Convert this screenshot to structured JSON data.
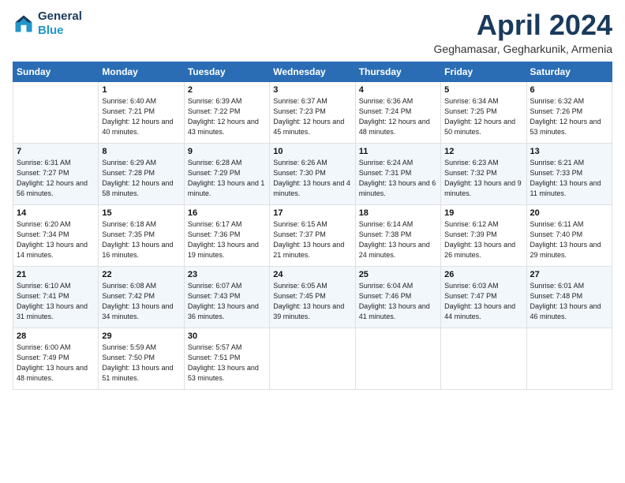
{
  "header": {
    "logo_line1": "General",
    "logo_line2": "Blue",
    "month": "April 2024",
    "location": "Geghamasar, Gegharkunik, Armenia"
  },
  "days_of_week": [
    "Sunday",
    "Monday",
    "Tuesday",
    "Wednesday",
    "Thursday",
    "Friday",
    "Saturday"
  ],
  "weeks": [
    [
      {
        "day": "",
        "sunrise": "",
        "sunset": "",
        "daylight": ""
      },
      {
        "day": "1",
        "sunrise": "Sunrise: 6:40 AM",
        "sunset": "Sunset: 7:21 PM",
        "daylight": "Daylight: 12 hours and 40 minutes."
      },
      {
        "day": "2",
        "sunrise": "Sunrise: 6:39 AM",
        "sunset": "Sunset: 7:22 PM",
        "daylight": "Daylight: 12 hours and 43 minutes."
      },
      {
        "day": "3",
        "sunrise": "Sunrise: 6:37 AM",
        "sunset": "Sunset: 7:23 PM",
        "daylight": "Daylight: 12 hours and 45 minutes."
      },
      {
        "day": "4",
        "sunrise": "Sunrise: 6:36 AM",
        "sunset": "Sunset: 7:24 PM",
        "daylight": "Daylight: 12 hours and 48 minutes."
      },
      {
        "day": "5",
        "sunrise": "Sunrise: 6:34 AM",
        "sunset": "Sunset: 7:25 PM",
        "daylight": "Daylight: 12 hours and 50 minutes."
      },
      {
        "day": "6",
        "sunrise": "Sunrise: 6:32 AM",
        "sunset": "Sunset: 7:26 PM",
        "daylight": "Daylight: 12 hours and 53 minutes."
      }
    ],
    [
      {
        "day": "7",
        "sunrise": "Sunrise: 6:31 AM",
        "sunset": "Sunset: 7:27 PM",
        "daylight": "Daylight: 12 hours and 56 minutes."
      },
      {
        "day": "8",
        "sunrise": "Sunrise: 6:29 AM",
        "sunset": "Sunset: 7:28 PM",
        "daylight": "Daylight: 12 hours and 58 minutes."
      },
      {
        "day": "9",
        "sunrise": "Sunrise: 6:28 AM",
        "sunset": "Sunset: 7:29 PM",
        "daylight": "Daylight: 13 hours and 1 minute."
      },
      {
        "day": "10",
        "sunrise": "Sunrise: 6:26 AM",
        "sunset": "Sunset: 7:30 PM",
        "daylight": "Daylight: 13 hours and 4 minutes."
      },
      {
        "day": "11",
        "sunrise": "Sunrise: 6:24 AM",
        "sunset": "Sunset: 7:31 PM",
        "daylight": "Daylight: 13 hours and 6 minutes."
      },
      {
        "day": "12",
        "sunrise": "Sunrise: 6:23 AM",
        "sunset": "Sunset: 7:32 PM",
        "daylight": "Daylight: 13 hours and 9 minutes."
      },
      {
        "day": "13",
        "sunrise": "Sunrise: 6:21 AM",
        "sunset": "Sunset: 7:33 PM",
        "daylight": "Daylight: 13 hours and 11 minutes."
      }
    ],
    [
      {
        "day": "14",
        "sunrise": "Sunrise: 6:20 AM",
        "sunset": "Sunset: 7:34 PM",
        "daylight": "Daylight: 13 hours and 14 minutes."
      },
      {
        "day": "15",
        "sunrise": "Sunrise: 6:18 AM",
        "sunset": "Sunset: 7:35 PM",
        "daylight": "Daylight: 13 hours and 16 minutes."
      },
      {
        "day": "16",
        "sunrise": "Sunrise: 6:17 AM",
        "sunset": "Sunset: 7:36 PM",
        "daylight": "Daylight: 13 hours and 19 minutes."
      },
      {
        "day": "17",
        "sunrise": "Sunrise: 6:15 AM",
        "sunset": "Sunset: 7:37 PM",
        "daylight": "Daylight: 13 hours and 21 minutes."
      },
      {
        "day": "18",
        "sunrise": "Sunrise: 6:14 AM",
        "sunset": "Sunset: 7:38 PM",
        "daylight": "Daylight: 13 hours and 24 minutes."
      },
      {
        "day": "19",
        "sunrise": "Sunrise: 6:12 AM",
        "sunset": "Sunset: 7:39 PM",
        "daylight": "Daylight: 13 hours and 26 minutes."
      },
      {
        "day": "20",
        "sunrise": "Sunrise: 6:11 AM",
        "sunset": "Sunset: 7:40 PM",
        "daylight": "Daylight: 13 hours and 29 minutes."
      }
    ],
    [
      {
        "day": "21",
        "sunrise": "Sunrise: 6:10 AM",
        "sunset": "Sunset: 7:41 PM",
        "daylight": "Daylight: 13 hours and 31 minutes."
      },
      {
        "day": "22",
        "sunrise": "Sunrise: 6:08 AM",
        "sunset": "Sunset: 7:42 PM",
        "daylight": "Daylight: 13 hours and 34 minutes."
      },
      {
        "day": "23",
        "sunrise": "Sunrise: 6:07 AM",
        "sunset": "Sunset: 7:43 PM",
        "daylight": "Daylight: 13 hours and 36 minutes."
      },
      {
        "day": "24",
        "sunrise": "Sunrise: 6:05 AM",
        "sunset": "Sunset: 7:45 PM",
        "daylight": "Daylight: 13 hours and 39 minutes."
      },
      {
        "day": "25",
        "sunrise": "Sunrise: 6:04 AM",
        "sunset": "Sunset: 7:46 PM",
        "daylight": "Daylight: 13 hours and 41 minutes."
      },
      {
        "day": "26",
        "sunrise": "Sunrise: 6:03 AM",
        "sunset": "Sunset: 7:47 PM",
        "daylight": "Daylight: 13 hours and 44 minutes."
      },
      {
        "day": "27",
        "sunrise": "Sunrise: 6:01 AM",
        "sunset": "Sunset: 7:48 PM",
        "daylight": "Daylight: 13 hours and 46 minutes."
      }
    ],
    [
      {
        "day": "28",
        "sunrise": "Sunrise: 6:00 AM",
        "sunset": "Sunset: 7:49 PM",
        "daylight": "Daylight: 13 hours and 48 minutes."
      },
      {
        "day": "29",
        "sunrise": "Sunrise: 5:59 AM",
        "sunset": "Sunset: 7:50 PM",
        "daylight": "Daylight: 13 hours and 51 minutes."
      },
      {
        "day": "30",
        "sunrise": "Sunrise: 5:57 AM",
        "sunset": "Sunset: 7:51 PM",
        "daylight": "Daylight: 13 hours and 53 minutes."
      },
      {
        "day": "",
        "sunrise": "",
        "sunset": "",
        "daylight": ""
      },
      {
        "day": "",
        "sunrise": "",
        "sunset": "",
        "daylight": ""
      },
      {
        "day": "",
        "sunrise": "",
        "sunset": "",
        "daylight": ""
      },
      {
        "day": "",
        "sunrise": "",
        "sunset": "",
        "daylight": ""
      }
    ]
  ]
}
